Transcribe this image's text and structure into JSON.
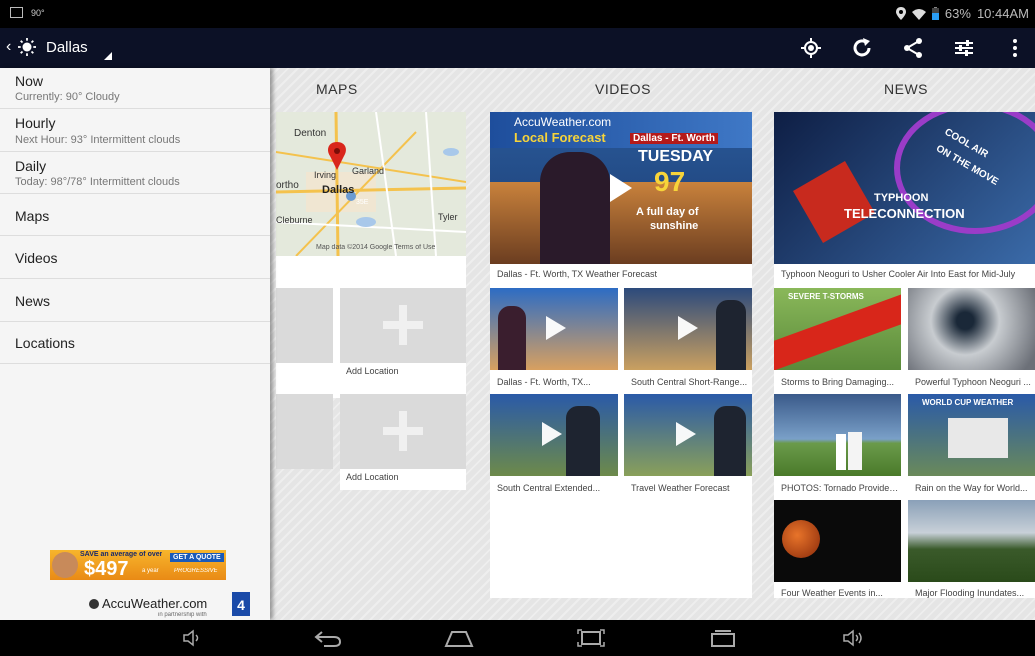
{
  "status_bar": {
    "left_text": "90°",
    "battery": "63%",
    "time": "10:44AM"
  },
  "app_bar": {
    "location": "Dallas"
  },
  "sections": {
    "maps": "MAPS",
    "videos": "VIDEOS",
    "news": "NEWS"
  },
  "drawer": {
    "items": [
      {
        "title": "Now",
        "sub": "Currently: 90° Cloudy"
      },
      {
        "title": "Hourly",
        "sub": "Next Hour: 93° Intermittent clouds"
      },
      {
        "title": "Daily",
        "sub": "Today: 98°/78° Intermittent clouds"
      },
      {
        "title": "Maps"
      },
      {
        "title": "Videos"
      },
      {
        "title": "News"
      },
      {
        "title": "Locations"
      }
    ],
    "ad": {
      "headline": "SAVE an average of over",
      "amount": "$497",
      "per": "a year",
      "button": "GET A QUOTE",
      "brand": "PROGRESSIVE"
    },
    "footer": {
      "brand": "AccuWeather.com",
      "partner": "in partnership with",
      "station": "4"
    }
  },
  "map": {
    "cities": [
      "Denton",
      "Irving",
      "Garland",
      "Dallas",
      "Cleburne",
      "Tyler",
      "ortho"
    ],
    "highway": "35E",
    "attribution": "Map data ©2014 Google   Terms of Use",
    "add_location_1": "Add Location",
    "add_location_2": "Add Location"
  },
  "videos": {
    "featured": {
      "caption": "Dallas - Ft. Worth, TX Weather Forecast",
      "brand": "AccuWeather.com",
      "show": "Local Forecast",
      "region": "Dallas - Ft. Worth",
      "day": "TUESDAY",
      "temp": "97",
      "desc1": "A full day of",
      "desc2": "sunshine"
    },
    "items": [
      {
        "caption": "Dallas - Ft. Worth, TX..."
      },
      {
        "caption": "South Central Short-Range..."
      },
      {
        "caption": "South Central Extended..."
      },
      {
        "caption": "Travel Weather Forecast"
      }
    ]
  },
  "news": {
    "featured": {
      "caption": "Typhoon Neoguri to Usher Cooler Air Into East for Mid-July",
      "label1": "COOL AIR",
      "label2": "ON THE MOVE",
      "label3": "TYPHOON",
      "label4": "TELECONNECTION"
    },
    "items": [
      {
        "caption": "Storms to Bring Damaging...",
        "label": "SEVERE T-STORMS"
      },
      {
        "caption": "Powerful Typhoon Neoguri ..."
      },
      {
        "caption": "PHOTOS: Tornado Provides..."
      },
      {
        "caption": "Rain on the Way for World...",
        "label": "WORLD CUP WEATHER"
      },
      {
        "caption": "Four Weather Events in..."
      },
      {
        "caption": "Major Flooding Inundates..."
      }
    ]
  },
  "colors": {
    "app_bar": "#0c1126",
    "map_pin": "#d9261c"
  }
}
